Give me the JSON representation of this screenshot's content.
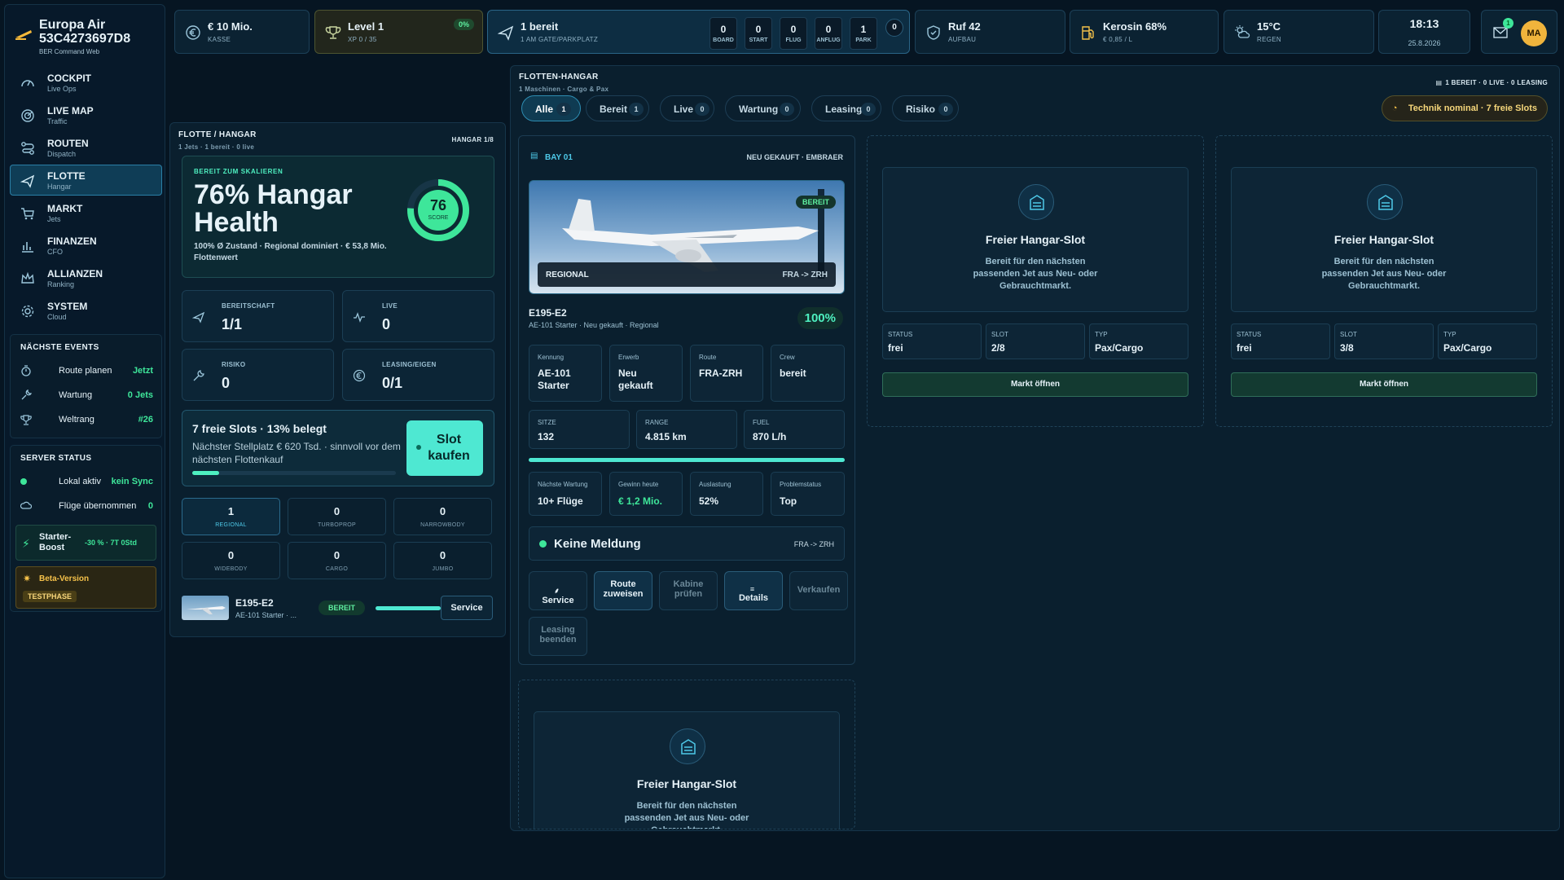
{
  "brand": {
    "name_line1": "Europa Air",
    "name_line2": "53C4273697D8",
    "sub": "BER Command Web"
  },
  "nav": [
    {
      "title": "COCKPIT",
      "sub": "Live Ops",
      "icon": "gauge-icon"
    },
    {
      "title": "LIVE MAP",
      "sub": "Traffic",
      "icon": "radar-icon"
    },
    {
      "title": "ROUTEN",
      "sub": "Dispatch",
      "icon": "route-icon"
    },
    {
      "title": "FLOTTE",
      "sub": "Hangar",
      "icon": "plane-icon",
      "active": true
    },
    {
      "title": "MARKT",
      "sub": "Jets",
      "icon": "cart-icon"
    },
    {
      "title": "FINANZEN",
      "sub": "CFO",
      "icon": "bar-chart-icon"
    },
    {
      "title": "ALLIANZEN",
      "sub": "Ranking",
      "icon": "crown-icon"
    },
    {
      "title": "SYSTEM",
      "sub": "Cloud",
      "icon": "gear-icon"
    }
  ],
  "events": {
    "title": "NÄCHSTE EVENTS",
    "items": [
      {
        "label": "Route planen",
        "value": "Jetzt"
      },
      {
        "label": "Wartung",
        "value": "0 Jets"
      },
      {
        "label": "Weltrang",
        "value": "#26"
      }
    ]
  },
  "server": {
    "title": "SERVER STATUS",
    "rows": [
      {
        "label": "Lokal aktiv",
        "value": "kein Sync"
      },
      {
        "label": "Flüge übernommen",
        "value": "0"
      }
    ],
    "boost_title_1": "Starter-",
    "boost_title_2": "Boost",
    "boost_value": "-30 % · 7T 0Std",
    "beta_title": "Beta-Version",
    "beta_badge": "TESTPHASE"
  },
  "topbar": {
    "cash": {
      "value": "€ 10 Mio.",
      "label": "KASSE"
    },
    "level": {
      "value": "Level 1",
      "label": "XP 0 / 35",
      "pct": "0%"
    },
    "ready": {
      "value": "1 bereit",
      "label": "1 AM GATE/PARKPLATZ",
      "phases": [
        {
          "n": "0",
          "p": "BOARD"
        },
        {
          "n": "0",
          "p": "START"
        },
        {
          "n": "0",
          "p": "FLUG"
        },
        {
          "n": "0",
          "p": "ANFLUG"
        },
        {
          "n": "1",
          "p": "PARK"
        }
      ],
      "alerts": "0"
    },
    "reputation": {
      "value": "Ruf 42",
      "label": "AUFBAU"
    },
    "fuel": {
      "value": "Kerosin 68%",
      "label": "€ 0,85 / L"
    },
    "weather": {
      "value": "15°C",
      "label": "REGEN"
    },
    "clock": {
      "time": "18:13",
      "date": "25.8.2026"
    },
    "mail_count": "1",
    "avatar": "MA"
  },
  "fleet": {
    "title": "FLOTTE / HANGAR",
    "sub": "1 Jets · 1 bereit · 0 live",
    "badge": "HANGAR 1/8",
    "health": {
      "kicker": "BEREIT ZUM SKALIEREN",
      "title_1": "76% Hangar",
      "title_2": "Health",
      "desc": "100% Ø Zustand · Regional dominiert · € 53,8 Mio. Flottenwert",
      "score": "76",
      "score_label": "SCORE",
      "score_value": 76
    },
    "stats": [
      {
        "label": "BEREITSCHAFT",
        "value": "1/1",
        "icon": "plane-icon"
      },
      {
        "label": "LIVE",
        "value": "0",
        "icon": "pulse-icon"
      },
      {
        "label": "RISIKO",
        "value": "0",
        "icon": "wrench-icon"
      },
      {
        "label": "LEASING/EIGEN",
        "value": "0/1",
        "icon": "euro-icon"
      }
    ],
    "slots": {
      "title": "7 freie Slots · 13% belegt",
      "desc": "Nächster Stellplatz € 620 Tsd. · sinnvoll vor dem nächsten Flottenkauf",
      "button_1": "Slot",
      "button_2": "kaufen",
      "fill": 0.13
    },
    "categories": [
      {
        "n": "1",
        "c": "REGIONAL",
        "active": true
      },
      {
        "n": "0",
        "c": "TURBOPROP"
      },
      {
        "n": "0",
        "c": "NARROWBODY"
      },
      {
        "n": "0",
        "c": "WIDEBODY"
      },
      {
        "n": "0",
        "c": "CARGO"
      },
      {
        "n": "0",
        "c": "JUMBO"
      }
    ],
    "jet": {
      "model": "E195-E2",
      "sub": "AE-101 Starter · ...",
      "status": "BEREIT",
      "button": "Service",
      "condition": 1.0
    }
  },
  "hangar": {
    "title": "FLOTTEN-HANGAR",
    "sub": "1 Maschinen · Cargo & Pax",
    "summary": "1 BEREIT · 0 LIVE · 0 LEASING",
    "tech": "Technik nominal · 7 freie Slots",
    "tabs": [
      {
        "label": "Alle",
        "count": "1",
        "active": true
      },
      {
        "label": "Bereit",
        "count": "1"
      },
      {
        "label": "Live",
        "count": "0"
      },
      {
        "label": "Wartung",
        "count": "0"
      },
      {
        "label": "Leasing",
        "count": "0"
      },
      {
        "label": "Risiko",
        "count": "0"
      }
    ],
    "bay": {
      "title": "BAY 01",
      "tag": "NEU GEKAUFT · EMBRAER",
      "image_badge": "BEREIT",
      "category": "REGIONAL",
      "route": "FRA -> ZRH",
      "model": "E195-E2",
      "sub": "AE-101 Starter · Neu gekauft · Regional",
      "condition": "100%",
      "info": [
        {
          "l": "Kennung",
          "v1": "AE-101",
          "v2": "Starter"
        },
        {
          "l": "Erwerb",
          "v1": "Neu",
          "v2": "gekauft"
        },
        {
          "l": "Route",
          "v1": "FRA-ZRH",
          "v2": ""
        },
        {
          "l": "Crew",
          "v1": "bereit",
          "v2": ""
        }
      ],
      "specs": [
        {
          "l": "SITZE",
          "v": "132"
        },
        {
          "l": "RANGE",
          "v": "4.815 km"
        },
        {
          "l": "FUEL",
          "v": "870 L/h"
        }
      ],
      "ops": [
        {
          "l": "Nächste Wartung",
          "v": "10+ Flüge"
        },
        {
          "l": "Gewinn heute",
          "v": "€ 1,2 Mio."
        },
        {
          "l": "Auslastung",
          "v": "52%"
        },
        {
          "l": "Problemstatus",
          "v": "Top"
        }
      ],
      "message": "Keine Meldung",
      "message_route": "FRA -> ZRH",
      "actions": [
        {
          "t1": "Service",
          "t2": ""
        },
        {
          "t1": "Route",
          "t2": "zuweisen"
        },
        {
          "t1": "Kabine",
          "t2": "prüfen"
        },
        {
          "t1": "Details",
          "t2": ""
        },
        {
          "t1": "Verkaufen",
          "t2": ""
        },
        {
          "t1": "Leasing",
          "t2": "beenden"
        }
      ]
    },
    "free_slot": {
      "title": "Freier Hangar-Slot",
      "desc_1": "Bereit für den nächsten",
      "desc_2": "passenden Jet aus Neu- oder",
      "desc_3": "Gebrauchtmarkt.",
      "button": "Markt öffnen",
      "l_status": "STATUS",
      "l_slot": "SLOT",
      "l_type": "TYP",
      "status": "frei",
      "type": "Pax/Cargo",
      "slots": [
        "2/8",
        "3/8"
      ]
    }
  }
}
